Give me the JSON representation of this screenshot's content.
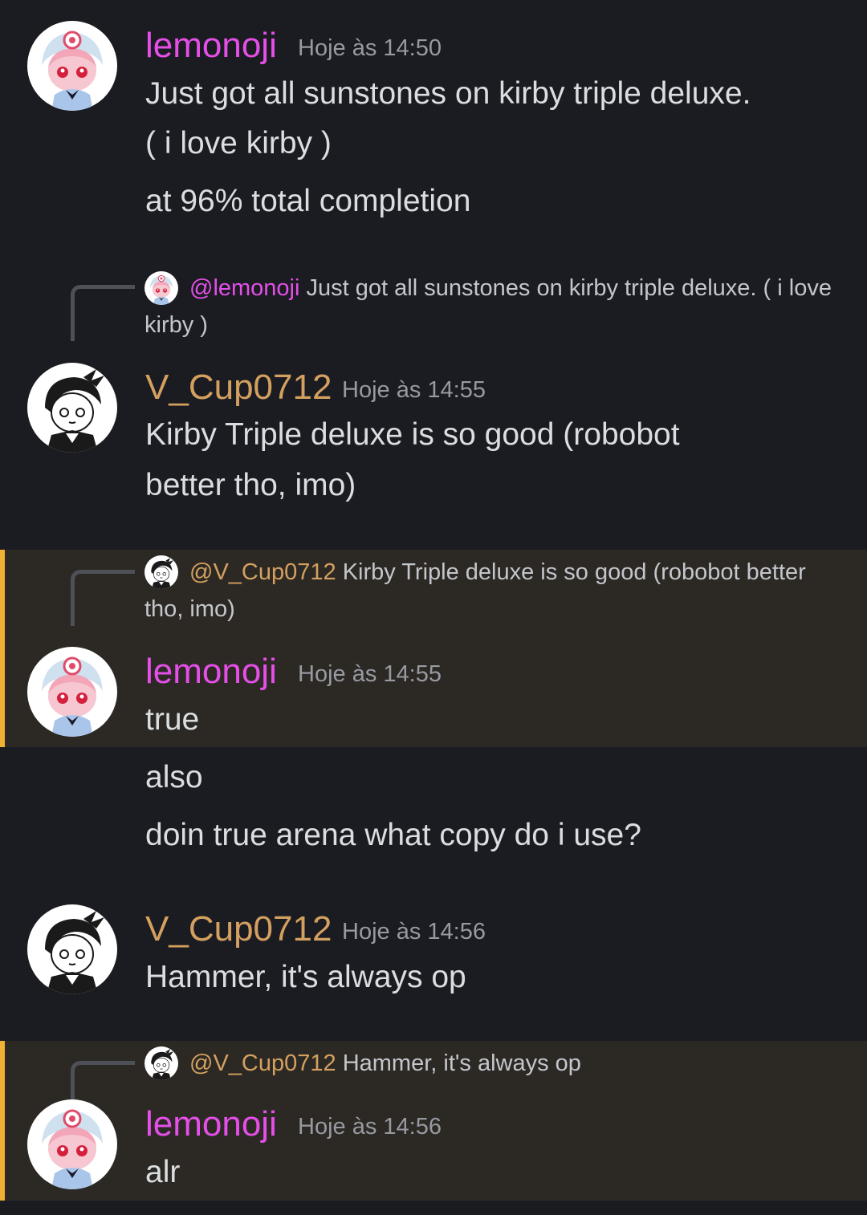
{
  "messages": [
    {
      "author": "lemonoji",
      "time": "Hoje às 14:50",
      "lines": [
        "Just got all sunstones on kirby triple deluxe.",
        "( i love kirby )",
        "at 96% total completion"
      ]
    },
    {
      "reply_to": {
        "mention": "@lemonoji",
        "text": "Just got all sunstones on kirby triple deluxe. ( i love kirby )"
      },
      "author": "V_Cup0712",
      "time": "Hoje às 14:55",
      "lines": [
        "Kirby Triple deluxe is so good (robobot",
        "better tho, imo)"
      ]
    },
    {
      "reply_to": {
        "mention": "@V_Cup0712",
        "text": "Kirby Triple deluxe is so good (robobot better tho, imo)"
      },
      "author": "lemonoji",
      "time": "Hoje às 14:55",
      "lines": [
        "true",
        "also",
        "doin true arena what copy do i use?"
      ]
    },
    {
      "author": "V_Cup0712",
      "time": "Hoje às 14:56",
      "lines": [
        "Hammer, it's always op"
      ]
    },
    {
      "reply_to": {
        "mention": "@V_Cup0712",
        "text": "Hammer, it's always op"
      },
      "author": "lemonoji",
      "time": "Hoje às 14:56",
      "lines": [
        "alr"
      ]
    }
  ],
  "colors": {
    "background": "#1b1c21",
    "highlight_background": "#2c2924",
    "highlight_border": "#f0b232",
    "lemonoji_name": "#e44fe8",
    "vcup_name": "#d4a060",
    "timestamp": "#989aa2"
  },
  "icons": {
    "lemonoji_avatar": "avatar-lemonoji-icon",
    "vcup_avatar": "avatar-vcup-icon"
  }
}
